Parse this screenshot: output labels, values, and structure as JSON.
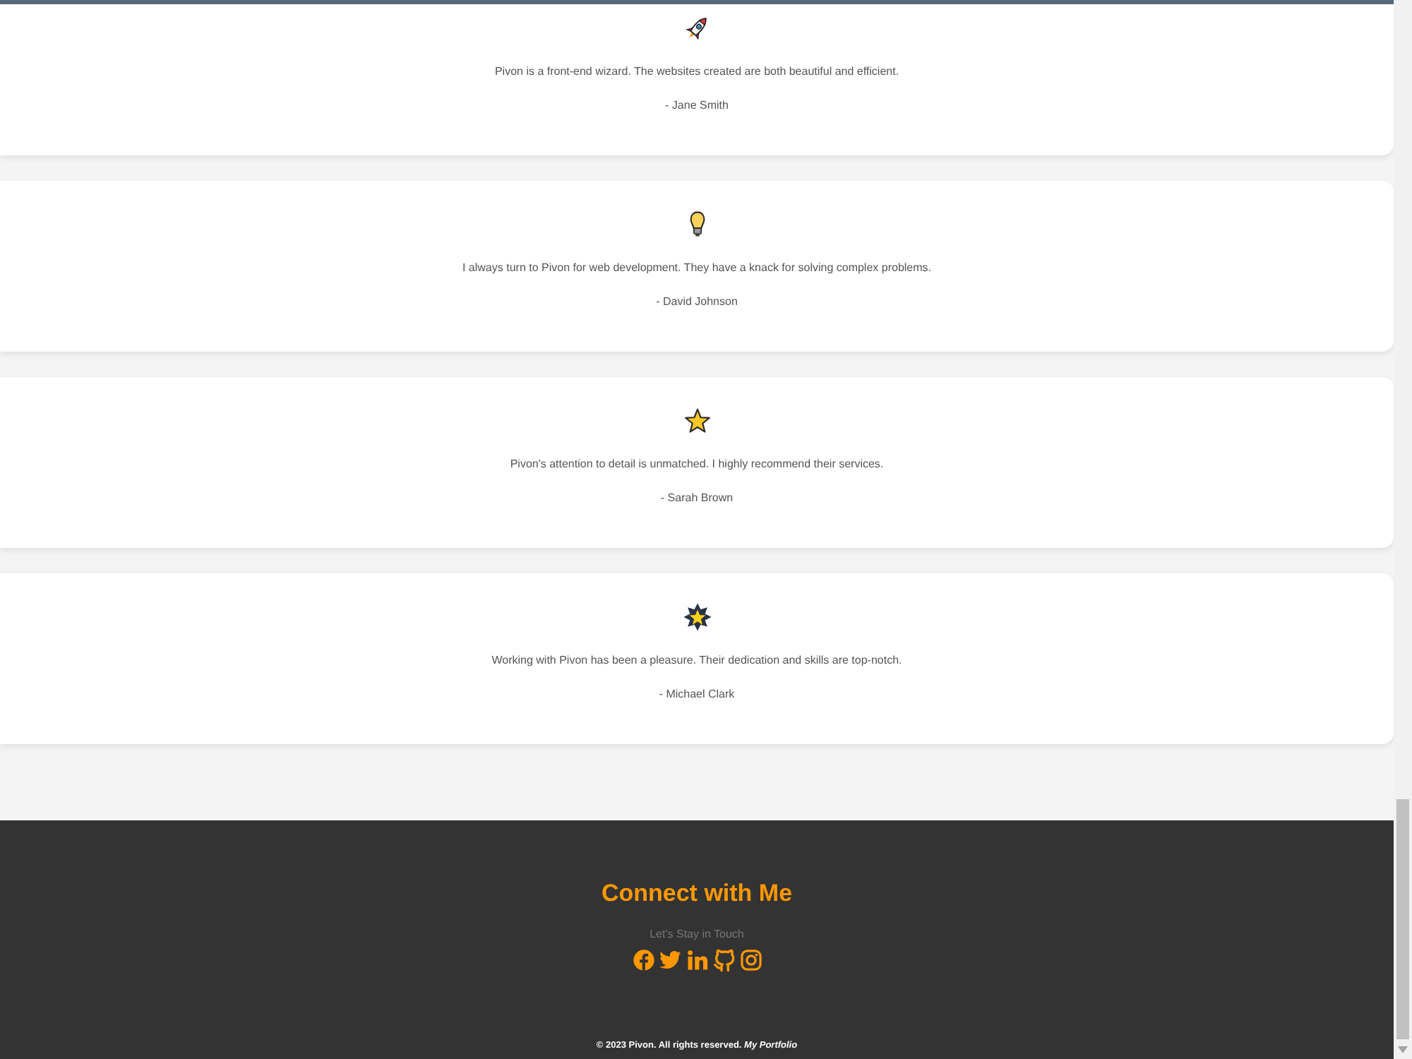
{
  "testimonials": [
    {
      "quote": "Pivon is a front-end wizard. The websites created are both beautiful and efficient.",
      "author": "- Jane Smith"
    },
    {
      "quote": "I always turn to Pivon for web development. They have a knack for solving complex problems.",
      "author": "- David Johnson"
    },
    {
      "quote": "Pivon's attention to detail is unmatched. I highly recommend their services.",
      "author": "- Sarah Brown"
    },
    {
      "quote": "Working with Pivon has been a pleasure. Their dedication and skills are top-notch.",
      "author": "- Michael Clark"
    }
  ],
  "footer": {
    "title": "Connect with Me",
    "subtitle": "Let's Stay in Touch",
    "copyright": "© 2023 Pivon. All rights reserved. *My Portfolio*"
  }
}
